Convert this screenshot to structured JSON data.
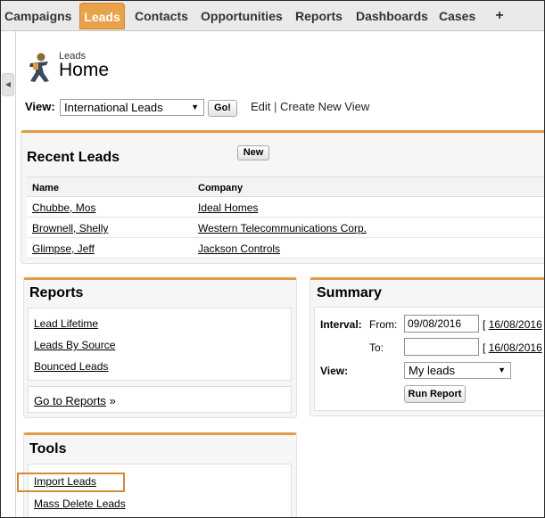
{
  "tabs": [
    {
      "label": "Campaigns"
    },
    {
      "label": "Leads"
    },
    {
      "label": "Contacts"
    },
    {
      "label": "Opportunities"
    },
    {
      "label": "Reports"
    },
    {
      "label": "Dashboards"
    },
    {
      "label": "Cases"
    },
    {
      "label": "+"
    }
  ],
  "header": {
    "section": "Leads",
    "title": "Home",
    "icon": "leads-person-icon"
  },
  "view_row": {
    "label": "View:",
    "selected": "International Leads",
    "go_label": "Go!",
    "edit_label": "Edit",
    "separator": "|",
    "create_label": "Create New View"
  },
  "recent_leads": {
    "title": "Recent Leads",
    "new_label": "New",
    "columns": [
      "Name",
      "Company"
    ],
    "rows": [
      {
        "name": "Chubbe, Mos",
        "company": "Ideal Homes"
      },
      {
        "name": "Brownell, Shelly",
        "company": "Western Telecommunications Corp."
      },
      {
        "name": "Glimpse, Jeff",
        "company": "Jackson Controls"
      }
    ]
  },
  "reports": {
    "title": "Reports",
    "links": [
      "Lead Lifetime",
      "Leads By Source",
      "Bounced Leads"
    ],
    "goto_label": "Go to Reports",
    "goto_suffix": "»"
  },
  "summary": {
    "title": "Summary",
    "interval_label": "Interval:",
    "from_label": "From:",
    "from_value": "09/08/2016",
    "from_link": "16/08/2016",
    "to_label": "To:",
    "to_value": "",
    "to_link": "16/08/2016",
    "bracket": "[",
    "view_label": "View:",
    "view_selected": "My leads",
    "run_label": "Run Report"
  },
  "tools": {
    "title": "Tools",
    "links": [
      "Import Leads",
      "Mass Delete Leads"
    ]
  },
  "colors": {
    "accent": "#e8a24a",
    "panel_border": "#e39b45",
    "highlight": "#d28a33"
  }
}
